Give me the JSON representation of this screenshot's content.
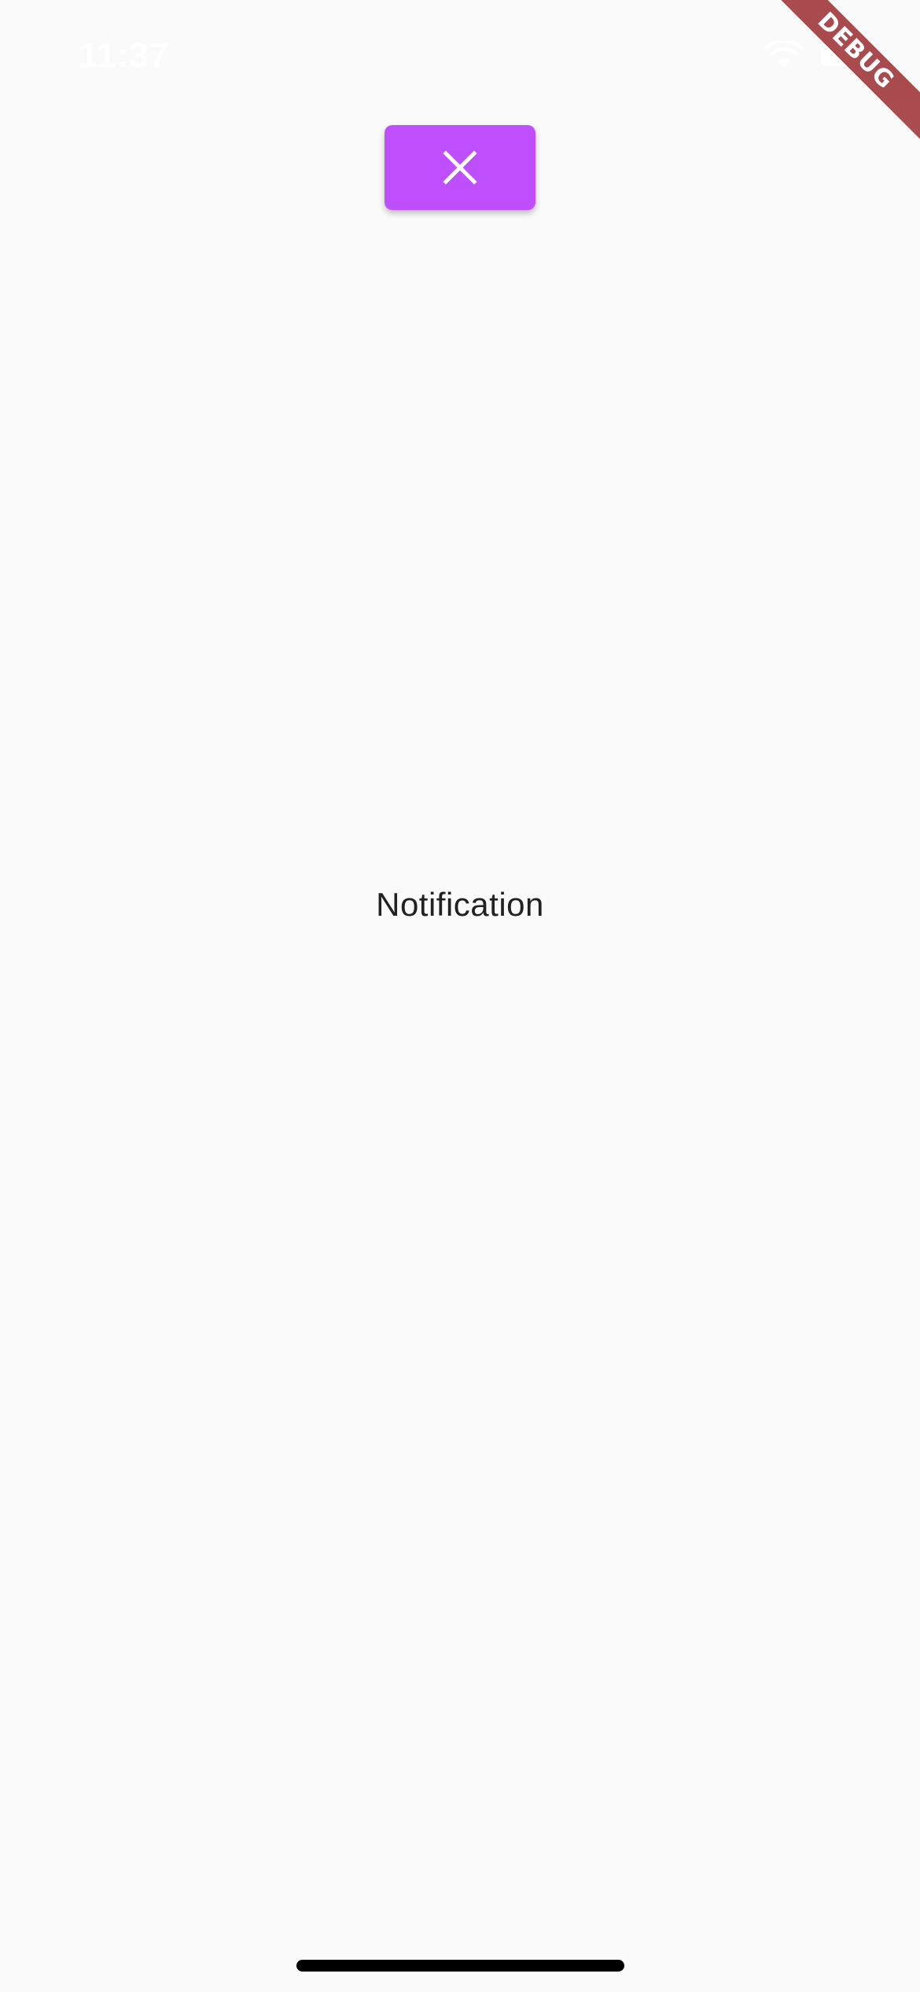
{
  "status_bar": {
    "time": "11:37",
    "icons": [
      "wifi-icon",
      "battery-icon"
    ]
  },
  "debug_banner": {
    "label": "DEBUG",
    "color": "#a33c40"
  },
  "close_button": {
    "icon": "close-icon",
    "background": "#bf4ffd"
  },
  "main": {
    "text": "Notification"
  },
  "colors": {
    "background": "#fafafa",
    "accent": "#bf4ffd",
    "text": "#222222"
  }
}
